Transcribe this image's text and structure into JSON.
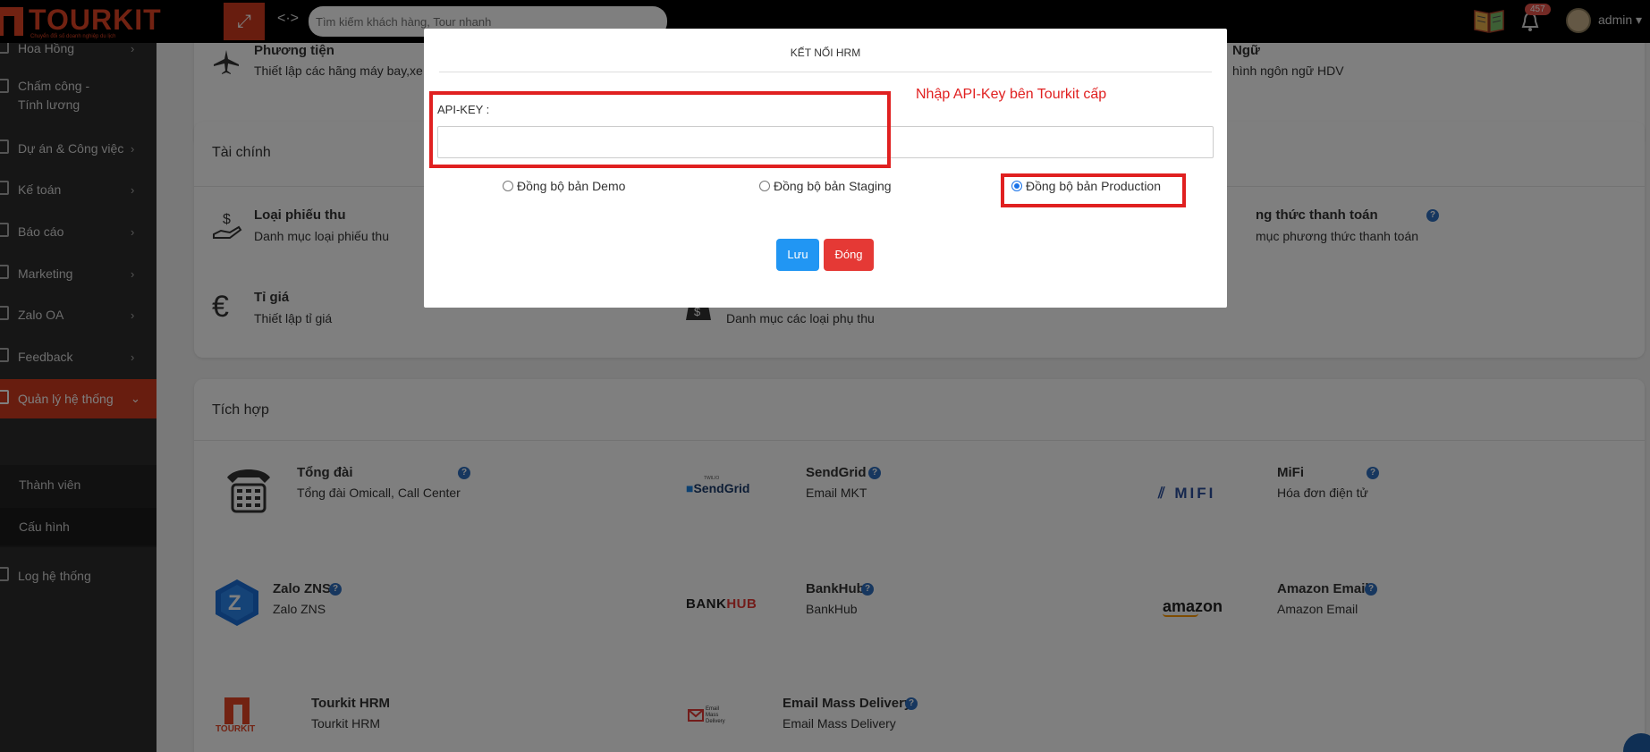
{
  "topbar": {
    "logo_text": "TOURKIT",
    "logo_tagline": "Chuyển đổi số doanh nghiệp du lịch",
    "search_placeholder": "Tìm kiếm khách hàng, Tour nhanh",
    "notification_count": "457",
    "user_name": "admin",
    "accent_color": "#d13a1f"
  },
  "sidebar": {
    "items": [
      {
        "label": "Hoa Hồng"
      },
      {
        "label": "Chấm công - Tính lương"
      },
      {
        "label": "Dự án & Công việc"
      },
      {
        "label": "Kế toán"
      },
      {
        "label": "Báo cáo"
      },
      {
        "label": "Marketing"
      },
      {
        "label": "Zalo OA"
      },
      {
        "label": "Feedback"
      },
      {
        "label": "Quản lý hệ thống"
      },
      {
        "label": "Log hệ thống"
      }
    ],
    "sub_items": [
      {
        "label": "Thành viên"
      },
      {
        "label": "Cấu hình"
      }
    ]
  },
  "top_card": {
    "transport_title": "Phương tiện",
    "transport_desc": "Thiết lập các hãng máy bay,xe",
    "language_title": "Ngữ",
    "language_desc": "hình ngôn ngữ HDV"
  },
  "finance": {
    "title": "Tài chính",
    "items": [
      {
        "title": "Loại phiếu thu",
        "desc": "Danh mục loại phiếu thu"
      },
      {
        "title": "ng thức thanh toán",
        "desc": "mục phương thức thanh toán"
      },
      {
        "title": "Tỉ giá",
        "desc": "Thiết lập tỉ giá"
      },
      {
        "title": "",
        "desc": "Danh mục các loại phụ thu"
      }
    ]
  },
  "integration": {
    "title": "Tích hợp",
    "items": [
      {
        "title": "Tổng đài",
        "desc": "Tổng đài Omicall, Call Center"
      },
      {
        "title": "SendGrid",
        "desc": "Email MKT",
        "logo": "SendGrid",
        "logo_small": "TWILIO"
      },
      {
        "title": "MiFi",
        "desc": "Hóa đơn điện tử",
        "logo": "MIFI"
      },
      {
        "title": "Zalo ZNS",
        "desc": "Zalo ZNS"
      },
      {
        "title": "BankHub",
        "desc": "BankHub",
        "logo_a": "BANK",
        "logo_b": "HUB"
      },
      {
        "title": "Amazon Email",
        "desc": "Amazon Email",
        "logo": "amazon"
      },
      {
        "title": "Tourkit HRM",
        "desc": "Tourkit HRM",
        "logo": "TOURKIT"
      },
      {
        "title": "Email Mass Delivery",
        "desc": "Email Mass Delivery",
        "logo": "Email Mass Delivery"
      }
    ]
  },
  "modal": {
    "title": "KẾT NỐI HRM",
    "api_label": "API-KEY :",
    "api_value": "",
    "options": [
      {
        "label": "Đồng bộ bản Demo",
        "checked": false
      },
      {
        "label": "Đồng bộ bản Staging",
        "checked": false
      },
      {
        "label": "Đồng bộ bản Production",
        "checked": true
      }
    ],
    "save_label": "Lưu",
    "close_label": "Đóng"
  },
  "annotation": {
    "text": "Nhập API-Key bên Tourkit cấp",
    "color": "#e02020"
  }
}
